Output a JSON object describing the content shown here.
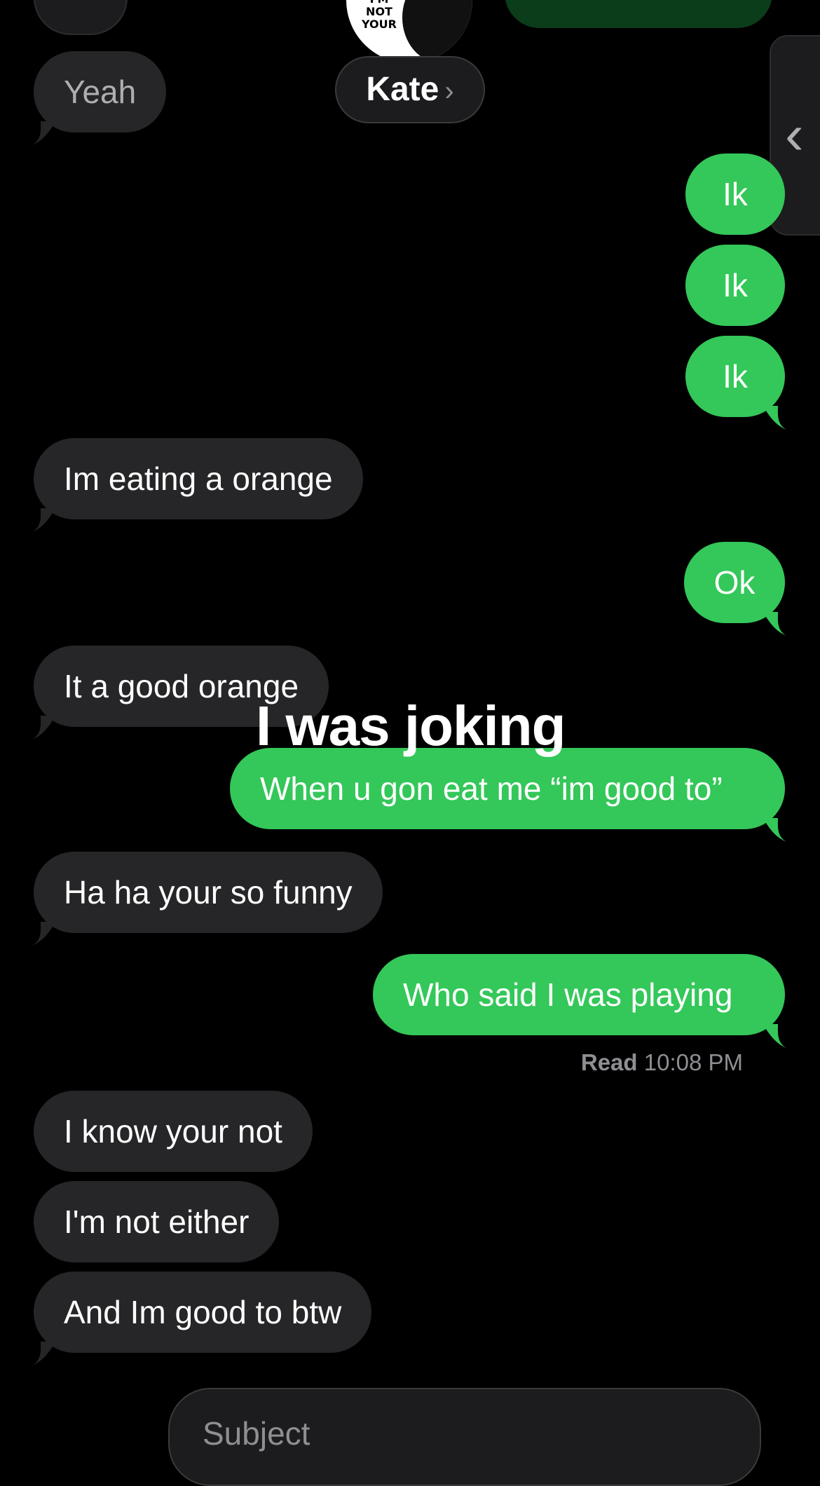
{
  "header": {
    "contact_name": "Kate",
    "chevron": "›",
    "avatar_text": "I'M NOT YOUR"
  },
  "side_handle": {
    "glyph": "‹"
  },
  "messages": {
    "m0": "Yeah",
    "m1": "Ik",
    "m2": "Ik",
    "m3": "Ik",
    "m4": "Im eating a orange",
    "m5": "Ok",
    "m6": "It a good orange",
    "m7": "When u gon eat me “im good to”",
    "m8": "Ha ha your so funny",
    "m9": "Who said I was playing",
    "m10": "I know your not",
    "m11": "I'm not either",
    "m12": "And Im good to btw"
  },
  "overlay_text": "I was joking",
  "receipt": {
    "label": "Read",
    "time": "10:08 PM"
  },
  "compose": {
    "subject_placeholder": "Subject"
  },
  "colors": {
    "incoming": "#262628",
    "outgoing": "#34c759",
    "background": "#000000"
  }
}
